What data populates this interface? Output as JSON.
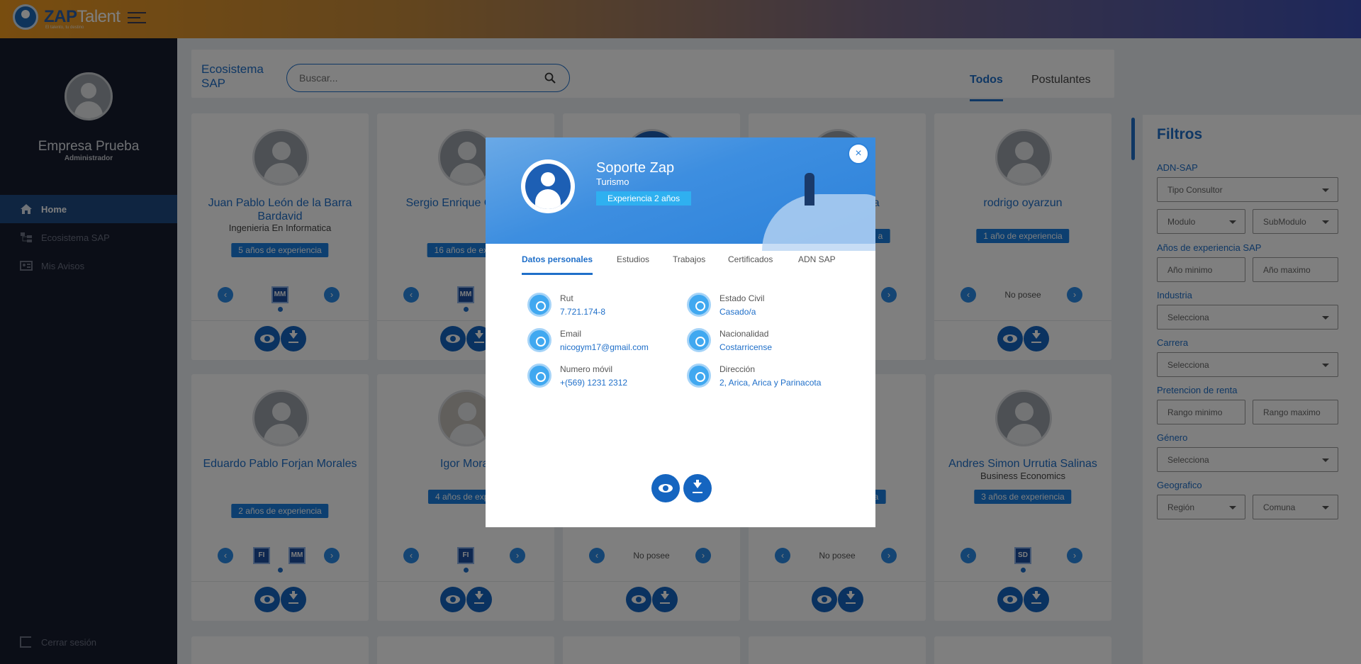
{
  "app": {
    "logo_brand": "ZAP",
    "logo_product": "Talent",
    "tagline": "El talento, tu destino"
  },
  "sidebar": {
    "company": "Empresa Prueba",
    "role": "Administrador",
    "items": [
      {
        "label": "Home",
        "icon": "home-icon"
      },
      {
        "label": "Ecosistema SAP",
        "icon": "hierarchy-icon"
      },
      {
        "label": "Mis Avisos",
        "icon": "id-card-icon"
      }
    ],
    "logout": "Cerrar sesión"
  },
  "header": {
    "title": "Ecosistema SAP",
    "search_placeholder": "Buscar...",
    "tabs": [
      "Todos",
      "Postulantes"
    ]
  },
  "cards": [
    {
      "name": "Juan Pablo León de la Barra Bardavid",
      "title": "Ingenieria En Informatica",
      "exp": "5 años de experiencia",
      "badges": [
        "MM"
      ]
    },
    {
      "name": "Sergio Enrique C. Leiva",
      "title": "",
      "exp": "16 años de expe",
      "badges": [
        "MM"
      ]
    },
    {
      "name": "",
      "title": "",
      "exp": "",
      "badges": []
    },
    {
      "name": "elma",
      "title": "",
      "exp": "a",
      "badges": []
    },
    {
      "name": "rodrigo oyarzun",
      "title": "",
      "exp": "1 año de experiencia",
      "badges": [],
      "none": "No posee"
    },
    {
      "name": "Eduardo Pablo Forjan Morales",
      "title": "",
      "exp": "2 años de experiencia",
      "badges": [
        "FI",
        "MM"
      ]
    },
    {
      "name": "Igor Moral",
      "title": "",
      "exp": "4 años de exper",
      "badges": [
        "FI"
      ]
    },
    {
      "name": "",
      "title": "",
      "exp": "",
      "badges": [],
      "none": "No posee"
    },
    {
      "name": "",
      "title": "",
      "exp": "a",
      "badges": [],
      "none": "No posee"
    },
    {
      "name": "Andres Simon Urrutia Salinas",
      "title": "Business Economics",
      "exp": "3 años de experiencia",
      "badges": [
        "SD"
      ]
    }
  ],
  "filters": {
    "title": "Filtros",
    "adn_label": "ADN-SAP",
    "tipo_consultor": "Tipo Consultor",
    "modulo": "Modulo",
    "submodulo": "SubModulo",
    "years_label": "Años de experiencia SAP",
    "year_min": "Año minimo",
    "year_max": "Año maximo",
    "industria_label": "Industria",
    "carrera_label": "Carrera",
    "renta_label": "Pretencion de renta",
    "renta_min": "Rango minimo",
    "renta_max": "Rango maximo",
    "genero_label": "Género",
    "geo_label": "Geografico",
    "region": "Región",
    "comuna": "Comuna",
    "select_placeholder": "Selecciona"
  },
  "modal": {
    "name": "Soporte Zap",
    "subtitle": "Turismo",
    "experience": "Experiencia 2 años",
    "tabs": [
      "Datos personales",
      "Estudios",
      "Trabajos",
      "Certificados",
      "ADN SAP"
    ],
    "fields": [
      {
        "label": "Rut",
        "value": "7.721.174-8",
        "icon": "fingerprint-icon"
      },
      {
        "label": "Estado Civil",
        "value": "Casado/a",
        "icon": "person-circle-icon"
      },
      {
        "label": "Email",
        "value": "nicogym17@gmail.com",
        "icon": "mail-icon"
      },
      {
        "label": "Nacionalidad",
        "value": "Costarricense",
        "icon": "flag-icon"
      },
      {
        "label": "Numero móvil",
        "value": "+(569) 1231 2312",
        "icon": "phone-icon"
      },
      {
        "label": "Dirección",
        "value": "2, Arica, Arica y Parinacota",
        "icon": "location-pin-icon"
      }
    ],
    "close": "×"
  },
  "colors": {
    "accent": "#1f6fc9",
    "sidebar": "#171c2e",
    "topbar_start": "#f19a1f",
    "topbar_end": "#3c4fb5"
  }
}
